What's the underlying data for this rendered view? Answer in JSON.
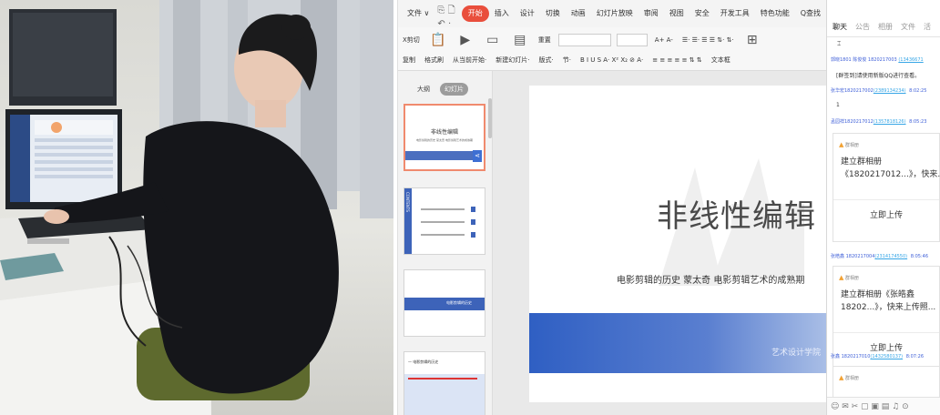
{
  "menu": {
    "items": [
      "文件 ∨",
      "开始",
      "插入",
      "设计",
      "切换",
      "动画",
      "幻灯片放映",
      "审阅",
      "视图",
      "安全",
      "开发工具",
      "特色功能"
    ],
    "active_index": 1,
    "quick_icons": "🖫 ⎙ ⎘ 🗋 ↶ · ↷ ▿",
    "search_label": "Q查找"
  },
  "ribbon": {
    "cut_label": "X剪切",
    "paste_label": "粘贴",
    "copy_label": "复制",
    "format_label": "格式刷",
    "play_label": "从当前开始·",
    "new_slide_label": "新建幻灯片·",
    "layout_label": "版式·",
    "section_label": "节·",
    "reset_label": "重置",
    "text_box_label": "文本框",
    "font_controls": "A+ A-",
    "list_controls": "☰· ☰· ☰ ☰ ⇅· ⇅·",
    "format_controls": "B I U S A· X² X₂ ⊘ A·",
    "align_controls": "≡ ≡ ≡ ≡ ≡ ⇅ ⇅"
  },
  "pane": {
    "tabs": [
      "大纲",
      "幻灯片"
    ],
    "active_tab": 1,
    "thumb1": {
      "title": "非线性编辑",
      "subtitle": "电影剪辑的历史 蒙太奇 电影剪辑艺术的成熟期"
    },
    "thumb2": {
      "side_text": "CONTENTS"
    },
    "thumb3": {
      "label": "电影剪辑的历史"
    },
    "thumb4": {
      "title": "一 电影剪辑的历史"
    }
  },
  "slide": {
    "title": "非线性编辑",
    "subtitle": "电影剪辑的历史  蒙太奇  电影剪辑艺术的成熟期",
    "footer": "艺术设计学院"
  },
  "chat": {
    "tabs": [
      "聊天",
      "公告",
      "相册",
      "文件",
      "活"
    ],
    "active_tab": 0,
    "messages": [
      {
        "name": "郭晓1801",
        "id": "陈俊俊 1820217003",
        "qq": "(13436671",
        "time": "",
        "text": "[群签到]请使用新版QQ进行查看。"
      },
      {
        "name": "张华宏1820217002",
        "id": "",
        "qq": "(2389134234)",
        "time": "8:02:25",
        "text": "1"
      },
      {
        "name": "孟园祥1820217012",
        "id": "",
        "qq": "(1357818126)",
        "time": "8:05:23",
        "text": ""
      },
      {
        "name": "张皓鑫 1820217004",
        "id": "",
        "qq": "(2314174550)",
        "time": "8:05:46",
        "text": ""
      },
      {
        "name": "张鑫 1820217010",
        "id": "",
        "qq": "(1432580137)",
        "time": "8:07:26",
        "text": ""
      }
    ],
    "cards": [
      {
        "header": "群相册",
        "line1": "建立群相册",
        "line2": "《1820217012...》，快来...",
        "action": "立即上传"
      },
      {
        "header": "群相册",
        "line1": "建立群相册《张皓鑫",
        "line2": "18202...》，快来上传照...",
        "action": "立即上传"
      },
      {
        "header": "群相册",
        "line1": "",
        "line2": "",
        "action": ""
      }
    ],
    "bottom_icons": "☺ ✉ ✂ ▢ ▣ ▤ ♫ ⊙"
  }
}
